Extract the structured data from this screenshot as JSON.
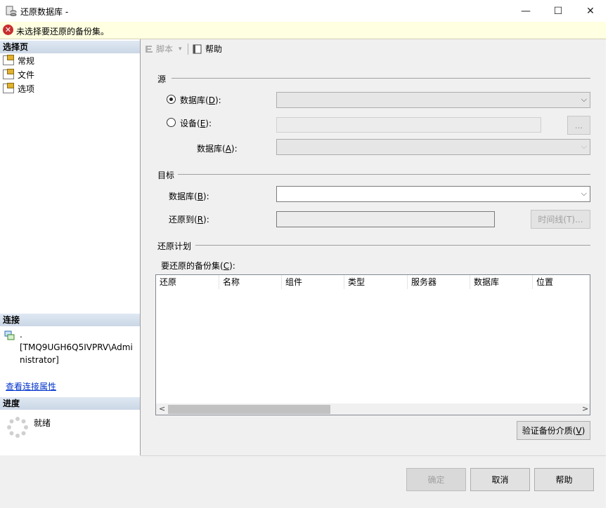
{
  "window": {
    "title": "还原数据库 -",
    "minimize_glyph": "—",
    "maximize_glyph": "☐",
    "close_glyph": "✕"
  },
  "error_bar": {
    "icon_glyph": "✕",
    "message": "未选择要还原的备份集。"
  },
  "left_pane": {
    "select_page_header": "选择页",
    "pages": [
      {
        "label": "常规",
        "icon": "page-icon"
      },
      {
        "label": "文件",
        "icon": "page-icon"
      },
      {
        "label": "选项",
        "icon": "page-icon"
      }
    ],
    "connection_header": "连接",
    "connection_dot": ".",
    "connection_user_line1": "[TMQ9UGH6Q5IVPRV\\Admi",
    "connection_user_line2": "nistrator]",
    "view_connection_link": "查看连接属性",
    "progress_header": "进度",
    "progress_status": "就绪"
  },
  "toolbar": {
    "script_label": "脚本",
    "help_label": "帮助"
  },
  "source": {
    "group_label": "源",
    "database_radio": {
      "text": "数据库(",
      "key": "D",
      "tail": "):"
    },
    "device_radio": {
      "text": "设备(",
      "key": "E",
      "tail": "):"
    },
    "browse_button": "...",
    "device_database_label": {
      "text": "数据库(",
      "key": "A",
      "tail": "):"
    }
  },
  "destination": {
    "group_label": "目标",
    "database_label": {
      "text": "数据库(",
      "key": "B",
      "tail": "):"
    },
    "restore_to_label": {
      "text": "还原到(",
      "key": "R",
      "tail": "):"
    },
    "timeline_button": "时间线(T)..."
  },
  "restore_plan": {
    "group_label": "还原计划",
    "backup_sets_label": {
      "text": "要还原的备份集(",
      "key": "C",
      "tail": "):"
    },
    "columns": [
      "还原",
      "名称",
      "组件",
      "类型",
      "服务器",
      "数据库",
      "位置"
    ],
    "verify_button": {
      "text": "验证备份介质(",
      "key": "V",
      "tail": ")"
    }
  },
  "footer": {
    "ok_button": "确定",
    "cancel_button": "取消",
    "help_button": "帮助"
  }
}
